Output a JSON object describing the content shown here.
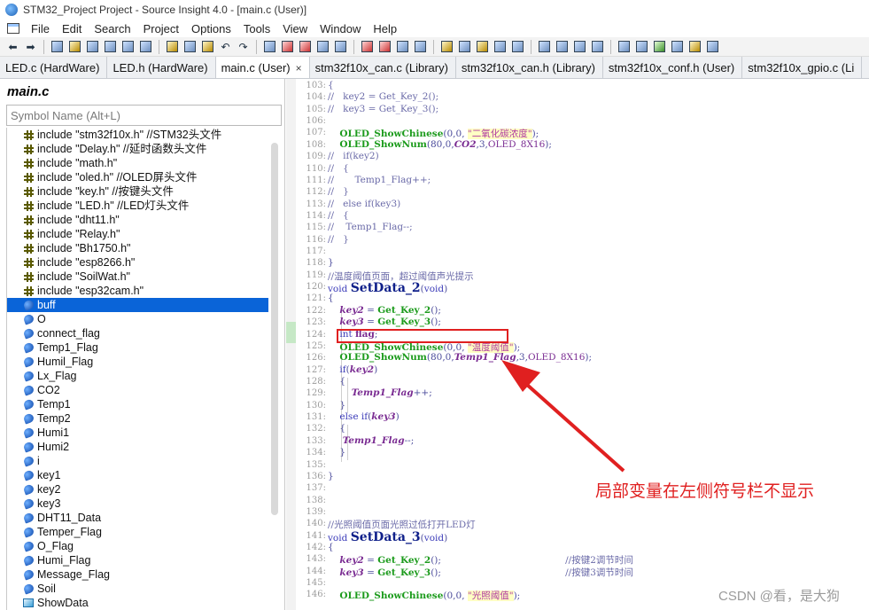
{
  "title_bar": {
    "title": "STM32_Project Project - Source Insight 4.0 - [main.c (User)]"
  },
  "menu": [
    "File",
    "Edit",
    "Search",
    "Project",
    "Options",
    "Tools",
    "View",
    "Window",
    "Help"
  ],
  "tabs": [
    {
      "label": "LED.c (HardWare)"
    },
    {
      "label": "LED.h (HardWare)"
    },
    {
      "label": "main.c (User)",
      "close": "×"
    },
    {
      "label": "stm32f10x_can.c (Library)"
    },
    {
      "label": "stm32f10x_can.h (Library)"
    },
    {
      "label": "stm32f10x_conf.h (User)"
    },
    {
      "label": "stm32f10x_gpio.c (Li"
    }
  ],
  "symbol_panel": {
    "filename": "main.c",
    "search_placeholder": "Symbol Name (Alt+L)",
    "items": [
      {
        "kind": "include",
        "label": "include \"stm32f10x.h\" //STM32头文件"
      },
      {
        "kind": "include",
        "label": "include \"Delay.h\" //延时函数头文件"
      },
      {
        "kind": "include",
        "label": "include \"math.h\""
      },
      {
        "kind": "include",
        "label": "include \"oled.h\" //OLED屏头文件"
      },
      {
        "kind": "include",
        "label": "include \"key.h\" //按键头文件"
      },
      {
        "kind": "include",
        "label": "include \"LED.h\" //LED灯头文件"
      },
      {
        "kind": "include",
        "label": "include \"dht11.h\""
      },
      {
        "kind": "include",
        "label": "include \"Relay.h\""
      },
      {
        "kind": "include",
        "label": "include \"Bh1750.h\""
      },
      {
        "kind": "include",
        "label": "include \"esp8266.h\""
      },
      {
        "kind": "include",
        "label": "include \"SoilWat.h\""
      },
      {
        "kind": "include",
        "label": "include \"esp32cam.h\""
      },
      {
        "kind": "variable",
        "label": "buff",
        "selected": true
      },
      {
        "kind": "variable",
        "label": "O"
      },
      {
        "kind": "variable",
        "label": "connect_flag"
      },
      {
        "kind": "variable",
        "label": "Temp1_Flag"
      },
      {
        "kind": "variable",
        "label": "Humil_Flag"
      },
      {
        "kind": "variable",
        "label": "Lx_Flag"
      },
      {
        "kind": "variable",
        "label": "CO2"
      },
      {
        "kind": "variable",
        "label": "Temp1"
      },
      {
        "kind": "variable",
        "label": "Temp2"
      },
      {
        "kind": "variable",
        "label": "Humi1"
      },
      {
        "kind": "variable",
        "label": "Humi2"
      },
      {
        "kind": "variable",
        "label": "i"
      },
      {
        "kind": "variable",
        "label": "key1"
      },
      {
        "kind": "variable",
        "label": "key2"
      },
      {
        "kind": "variable",
        "label": "key3"
      },
      {
        "kind": "variable",
        "label": "DHT11_Data"
      },
      {
        "kind": "variable",
        "label": "Temper_Flag"
      },
      {
        "kind": "variable",
        "label": "O_Flag"
      },
      {
        "kind": "variable",
        "label": "Humi_Flag"
      },
      {
        "kind": "variable",
        "label": "Message_Flag"
      },
      {
        "kind": "variable",
        "label": "Soil"
      },
      {
        "kind": "function",
        "label": "ShowData"
      }
    ]
  },
  "code_lines": [
    {
      "n": "103:",
      "html": "<span class='cm'>{</span>"
    },
    {
      "n": "104:",
      "html": "<span class='cm'>//   key2 = Get_Key_2();</span>"
    },
    {
      "n": "105:",
      "html": "<span class='cm'>//   key3 = Get_Key_3();</span>"
    },
    {
      "n": "106:",
      "html": ""
    },
    {
      "n": "107:",
      "html": "    <span class='fnc'>OLED_ShowChinese</span>(0,0, <span class='str dq'>\"二氧化碳浓度\"</span>);"
    },
    {
      "n": "108:",
      "html": "    <span class='fnc'>OLED_ShowNum</span>(80,0,<span class='vr'>CO2</span>,3,<span class='mac'>OLED_8X16</span>);"
    },
    {
      "n": "109:",
      "html": "<span class='cm'>//   if(key2)</span>"
    },
    {
      "n": "110:",
      "html": "<span class='cm'>//   {</span>"
    },
    {
      "n": "111:",
      "html": "<span class='cm'>//       Temp1_Flag++;</span>"
    },
    {
      "n": "112:",
      "html": "<span class='cm'>//   }</span>"
    },
    {
      "n": "113:",
      "html": "<span class='cm'>//   else if(key3)</span>"
    },
    {
      "n": "114:",
      "html": "<span class='cm'>//   {</span>"
    },
    {
      "n": "115:",
      "html": "<span class='cm'>//    Temp1_Flag--;</span>"
    },
    {
      "n": "116:",
      "html": "<span class='cm'>//   }</span>"
    },
    {
      "n": "117:",
      "html": ""
    },
    {
      "n": "118:",
      "html": "}"
    },
    {
      "n": "119:",
      "html": "<span class='cm'>//温度阈值页面，超过阈值声光提示</span>"
    },
    {
      "n": "120:",
      "html": "<span class='kw'>void</span> <span class='bigfn'>SetData_2</span>(<span class='kw'>void</span>)"
    },
    {
      "n": "121:",
      "html": "{"
    },
    {
      "n": "122:",
      "html": "    <span class='vr'>key2</span> = <span class='fnc'>Get_Key_2</span>();"
    },
    {
      "n": "123:",
      "html": "    <span class='vr'>key3</span> = <span class='fnc'>Get_Key_3</span>();"
    },
    {
      "n": "124:",
      "html": "    <span class='kw'>int</span> <span class='vr' style='font-style:normal'>flag</span>;"
    },
    {
      "n": "125:",
      "html": "    <span class='fnc'>OLED_ShowChinese</span>(0,0, <span class='str dq'>\"温度阈值\"</span>);"
    },
    {
      "n": "126:",
      "html": "    <span class='fnc'>OLED_ShowNum</span>(80,0,<span class='vr'>Temp1_Flag</span>,3,<span class='mac'>OLED_8X16</span>);"
    },
    {
      "n": "127:",
      "html": "    <span class='kw'>if</span>(<span class='vr'>key2</span>)"
    },
    {
      "n": "128:",
      "html": "    {"
    },
    {
      "n": "129:",
      "html": "        <span class='vr'>Temp1_Flag</span>++;"
    },
    {
      "n": "130:",
      "html": "    }"
    },
    {
      "n": "131:",
      "html": "    <span class='kw'>else if</span>(<span class='vr'>key3</span>)"
    },
    {
      "n": "132:",
      "html": "    {"
    },
    {
      "n": "133:",
      "html": "     <span class='vr'>Temp1_Flag</span>--;"
    },
    {
      "n": "134:",
      "html": "    }"
    },
    {
      "n": "135:",
      "html": ""
    },
    {
      "n": "136:",
      "html": "}"
    },
    {
      "n": "137:",
      "html": ""
    },
    {
      "n": "138:",
      "html": ""
    },
    {
      "n": "139:",
      "html": ""
    },
    {
      "n": "140:",
      "html": "<span class='cm'>//光照阈值页面光照过低打开LED灯</span>"
    },
    {
      "n": "141:",
      "html": "<span class='kw'>void</span> <span class='bigfn'>SetData_3</span>(<span class='kw'>void</span>)"
    },
    {
      "n": "142:",
      "html": "{"
    },
    {
      "n": "143:",
      "html": "    <span class='vr'>key2</span> = <span class='fnc'>Get_Key_2</span>();                                          <span class='cm'>//按键2调节时间</span>"
    },
    {
      "n": "144:",
      "html": "    <span class='vr'>key3</span> = <span class='fnc'>Get_Key_3</span>();                                          <span class='cm'>//按键3调节时间</span>"
    },
    {
      "n": "145:",
      "html": ""
    },
    {
      "n": "146:",
      "html": "    <span class='fnc'>OLED_ShowChinese</span>(0,0, <span class='str dq'>\"光照阈值\"</span>);"
    }
  ],
  "annotation": {
    "text": "局部变量在左侧符号栏不显示",
    "color": "#e02020"
  },
  "watermark": "CSDN @看，是大狗"
}
